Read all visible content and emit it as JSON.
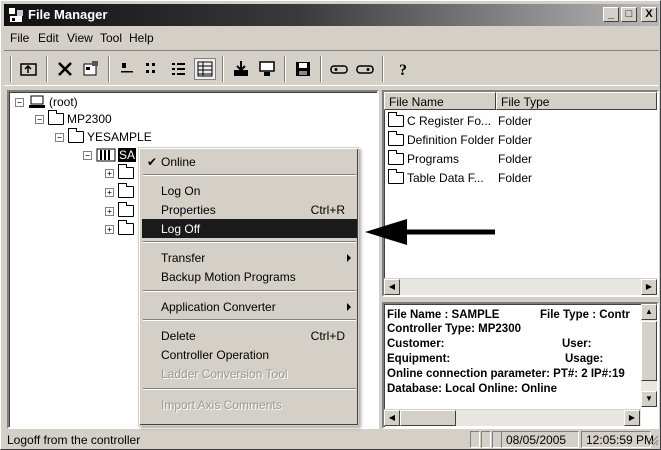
{
  "window": {
    "title": "File Manager",
    "controls": [
      "_",
      "□",
      "X"
    ]
  },
  "menu": {
    "items": [
      "File",
      "Edit",
      "View",
      "Tool",
      "Help"
    ]
  },
  "toolbar": {
    "icons": [
      "up-folder-icon",
      "delete-icon",
      "properties-icon",
      "large-icons-icon",
      "small-icons-icon",
      "list-icon",
      "details-icon",
      "download-icon",
      "upload-icon",
      "save-icon",
      "online-icon",
      "offline-icon",
      "help-icon"
    ]
  },
  "tree": {
    "root": "(root)",
    "mp2300": "MP2300",
    "yesample": "YESAMPLE",
    "sample": "SA"
  },
  "list": {
    "col_name": "File Name",
    "col_type": "File Type",
    "rows": [
      {
        "name": "C Register Fo...",
        "type": "Folder"
      },
      {
        "name": "Definition Folder",
        "type": "Folder"
      },
      {
        "name": "Programs",
        "type": "Folder"
      },
      {
        "name": "Table Data F...",
        "type": "Folder"
      }
    ]
  },
  "info": {
    "line1a": "File Name : SAMPLE",
    "line1b": "File Type : Contr",
    "line2": "Controller Type: MP2300",
    "line3a": "Customer:",
    "line3b": "User:",
    "line4a": "Equipment:",
    "line4b": "Usage:",
    "line5": "Online connection parameter: PT#: 2 IP#:19",
    "line6": "Database: Local  Online: Online"
  },
  "context_menu": {
    "online": "Online",
    "log_on": "Log On",
    "properties": "Properties",
    "properties_shortcut": "Ctrl+R",
    "log_off": "Log Off",
    "transfer": "Transfer",
    "backup": "Backup Motion Programs",
    "app_converter": "Application Converter",
    "delete": "Delete",
    "delete_shortcut": "Ctrl+D",
    "controller_operation": "Controller Operation",
    "ladder_conversion": "Ladder Conversion Tool",
    "import_axis": "Import Axis Comments"
  },
  "status": {
    "message": "Logoff from the controller",
    "date": "08/05/2005",
    "time": "12:05:59 PM"
  }
}
